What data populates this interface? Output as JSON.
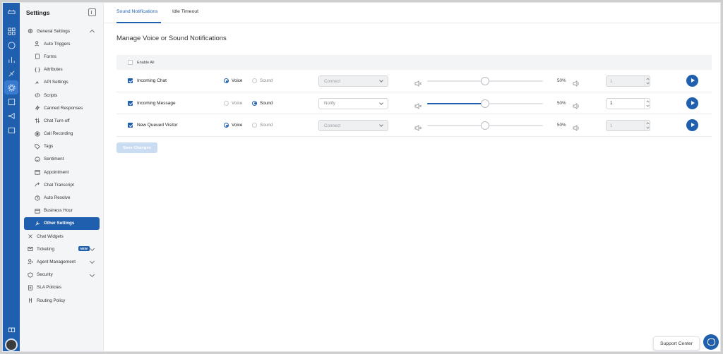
{
  "sidebar": {
    "title": "Settings",
    "items": [
      {
        "label": "General Settings",
        "icon": "gear-icon",
        "expanded": true
      },
      {
        "label": "Auto Triggers",
        "icon": "users-icon"
      },
      {
        "label": "Forms",
        "icon": "form-icon"
      },
      {
        "label": "Attributes",
        "icon": "braces-icon"
      },
      {
        "label": "API Settings",
        "icon": "link-icon"
      },
      {
        "label": "Scripts",
        "icon": "code-icon"
      },
      {
        "label": "Canned Responses",
        "icon": "bolt-icon"
      },
      {
        "label": "Chat Turn-off",
        "icon": "toggle-icon"
      },
      {
        "label": "Call Recording",
        "icon": "record-icon"
      },
      {
        "label": "Tags",
        "icon": "tag-icon"
      },
      {
        "label": "Sentiment",
        "icon": "smile-icon"
      },
      {
        "label": "Appointment",
        "icon": "calendar-icon"
      },
      {
        "label": "Chat Transcript",
        "icon": "forward-icon"
      },
      {
        "label": "Auto Resolve",
        "icon": "clock-icon"
      },
      {
        "label": "Business Hour",
        "icon": "calendar-icon"
      },
      {
        "label": "Other Settings",
        "icon": "wrench-icon",
        "active": true
      },
      {
        "label": "Chat Widgets",
        "icon": "widget-icon"
      },
      {
        "label": "Ticketing",
        "icon": "mail-icon",
        "badge": "NEW"
      },
      {
        "label": "Agent Management",
        "icon": "user-add-icon"
      },
      {
        "label": "Security",
        "icon": "shield-icon"
      },
      {
        "label": "SLA Policies",
        "icon": "document-icon"
      },
      {
        "label": "Routing Policy",
        "icon": "route-icon"
      }
    ]
  },
  "tabs": [
    {
      "label": "Sound Notifications",
      "active": true
    },
    {
      "label": "Idle Timeout",
      "active": false
    }
  ],
  "heading": "Manage Voice or Sound Notifications",
  "table": {
    "enable_all_label": "Enable All",
    "rows": [
      {
        "name": "Incoming Chat",
        "checked": true,
        "voice_label": "Voice",
        "sound_label": "Sound",
        "mode": "Voice",
        "select": "Connect",
        "select_disabled": true,
        "volume_pct": 50,
        "volume_label": "50%",
        "repeat": "1",
        "repeat_disabled": true
      },
      {
        "name": "Incoming Message",
        "checked": true,
        "voice_label": "Voice",
        "sound_label": "Sound",
        "mode": "Sound",
        "select": "Notify",
        "select_disabled": false,
        "volume_pct": 50,
        "volume_label": "50%",
        "repeat": "1",
        "repeat_disabled": false
      },
      {
        "name": "New Queued Visitor",
        "checked": true,
        "voice_label": "Voice",
        "sound_label": "Sound",
        "mode": "Voice",
        "select": "Connect",
        "select_disabled": true,
        "volume_pct": 50,
        "volume_label": "50%",
        "repeat": "1",
        "repeat_disabled": true
      }
    ]
  },
  "save_label": "Save Changes",
  "support_label": "Support Center",
  "colors": {
    "primary": "#1f5fad",
    "save_disabled": "#c9dcf2"
  }
}
